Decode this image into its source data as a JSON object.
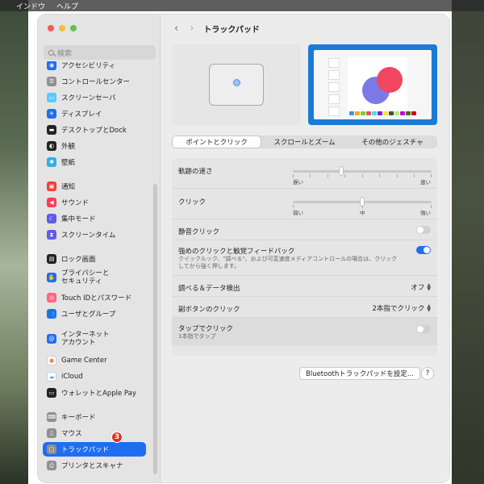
{
  "menubar": {
    "items": [
      "インドウ",
      "ヘルプ"
    ]
  },
  "search": {
    "placeholder": "検索"
  },
  "sidebar": {
    "items": [
      {
        "label": "アクセシビリティ",
        "icon": "accessibility-icon",
        "color": "#1f6ef0"
      },
      {
        "label": "コントロールセンター",
        "icon": "control-center-icon",
        "color": "#8e8e93"
      },
      {
        "label": "スクリーンセーバ",
        "icon": "screensaver-icon",
        "color": "#5ac8fa"
      },
      {
        "label": "ディスプレイ",
        "icon": "display-icon",
        "color": "#1f6ef0"
      },
      {
        "label": "デスクトップとDock",
        "icon": "desktop-dock-icon",
        "color": "#222222"
      },
      {
        "label": "外観",
        "icon": "appearance-icon",
        "color": "#222222"
      },
      {
        "label": "壁紙",
        "icon": "wallpaper-icon",
        "color": "#32ade6"
      },
      {
        "label": "通知",
        "icon": "notifications-icon",
        "color": "#ff3b30"
      },
      {
        "label": "サウンド",
        "icon": "sound-icon",
        "color": "#ff3b58"
      },
      {
        "label": "集中モード",
        "icon": "focus-icon",
        "color": "#5e5ce6"
      },
      {
        "label": "スクリーンタイム",
        "icon": "screen-time-icon",
        "color": "#5e5ce6"
      },
      {
        "label": "ロック画面",
        "icon": "lock-screen-icon",
        "color": "#222222"
      },
      {
        "label": "プライバシーと\nセキュリティ",
        "icon": "privacy-hand-icon",
        "color": "#1f6ef0"
      },
      {
        "label": "Touch IDとパスワード",
        "icon": "touch-id-icon",
        "color": "#ff6482"
      },
      {
        "label": "ユーザとグループ",
        "icon": "users-groups-icon",
        "color": "#1f6ef0"
      },
      {
        "label": "インターネット\nアカウント",
        "icon": "internet-accounts-icon",
        "color": "#1f6ef0"
      },
      {
        "label": "Game Center",
        "icon": "game-center-icon",
        "color": "#ffffff"
      },
      {
        "label": "iCloud",
        "icon": "icloud-icon",
        "color": "#ffffff"
      },
      {
        "label": "ウォレットとApple Pay",
        "icon": "wallet-icon",
        "color": "#222222"
      },
      {
        "label": "キーボード",
        "icon": "keyboard-icon",
        "color": "#8e8e93"
      },
      {
        "label": "マウス",
        "icon": "mouse-icon",
        "color": "#8e8e93"
      },
      {
        "label": "トラックパッド",
        "icon": "trackpad-icon",
        "color": "#8e8e93"
      },
      {
        "label": "プリンタとスキャナ",
        "icon": "printer-icon",
        "color": "#8e8e93"
      }
    ],
    "active_item": "トラックパッド"
  },
  "annotation_badge": "3",
  "toolbar": {
    "back": "‹",
    "forward": "›",
    "title": "トラックパッド"
  },
  "tabs": [
    {
      "label": "ポイントとクリック",
      "active": true
    },
    {
      "label": "スクロールとズーム",
      "active": false
    },
    {
      "label": "その他のジェスチャ",
      "active": false
    }
  ],
  "settings": {
    "tracking": {
      "label": "軌跡の速さ",
      "min_label": "遅い",
      "max_label": "速い",
      "level": 0.35
    },
    "click": {
      "label": "クリック",
      "min_label": "弱い",
      "mid_label": "中",
      "max_label": "強い",
      "level": 0.5
    },
    "silent_click": {
      "label": "静音クリック",
      "on": false
    },
    "force_click": {
      "label": "強めのクリックと触覚フィードバック",
      "desc1": "クイックルック、\"調べる\"、および可変速度メディアコントロールの場合は、クリック",
      "desc2": "してから強く押します。",
      "on": true
    },
    "lookup": {
      "label": "調べる＆データ検出",
      "value": "オフ"
    },
    "secondary": {
      "label": "副ボタンのクリック",
      "value": "2本指でクリック"
    },
    "tap_click": {
      "label": "タップでクリック",
      "sub": "1本指でタップ",
      "on": false
    }
  },
  "buttons": {
    "bluetooth": "Bluetoothトラックパッドを設定...",
    "help": "?"
  },
  "colors": {
    "accent": "#1f6ef0",
    "badge": "#e0332a"
  }
}
